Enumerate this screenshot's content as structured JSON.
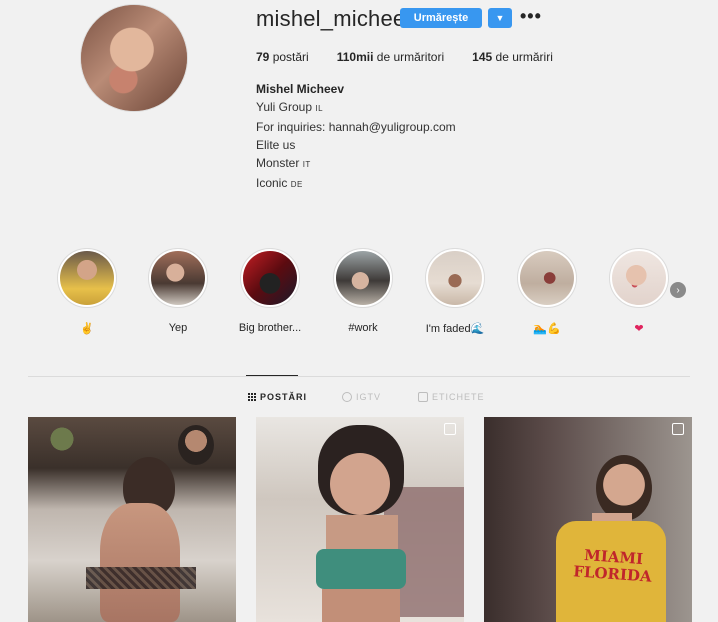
{
  "profile": {
    "username": "mishel_micheev",
    "follow_label": "Urmărește",
    "stats": [
      {
        "value": "79",
        "label": "postări"
      },
      {
        "value": "110mii",
        "label": "de urmăritori"
      },
      {
        "value": "145",
        "label": "de urmăriri"
      }
    ],
    "bio": {
      "name": "Mishel Micheev",
      "line1": "Yuli Group",
      "line1_tag": "IL",
      "line2": "For inquiries: hannah@yuligroup.com",
      "line3": "Elite us",
      "line4": "Monster",
      "line4_tag": "IT",
      "line5": "Iconic",
      "line5_tag": "DE"
    }
  },
  "highlights": [
    {
      "label": "✌"
    },
    {
      "label": "Yep"
    },
    {
      "label": "Big brother..."
    },
    {
      "label": "#work"
    },
    {
      "label": "I'm faded🌊"
    },
    {
      "label": "🏊💪"
    },
    {
      "label": "❤"
    }
  ],
  "tabs": [
    {
      "label": "POSTĂRI"
    },
    {
      "label": "IGTV"
    },
    {
      "label": "ETICHETE"
    }
  ],
  "posts": [
    {
      "caption": ""
    },
    {
      "caption": ""
    },
    {
      "caption": "MIAMI FLORIDA"
    }
  ],
  "colors": {
    "accent": "#3897f0",
    "text": "#262626",
    "muted": "#bdbdbd",
    "background": "#f1f1f1"
  }
}
